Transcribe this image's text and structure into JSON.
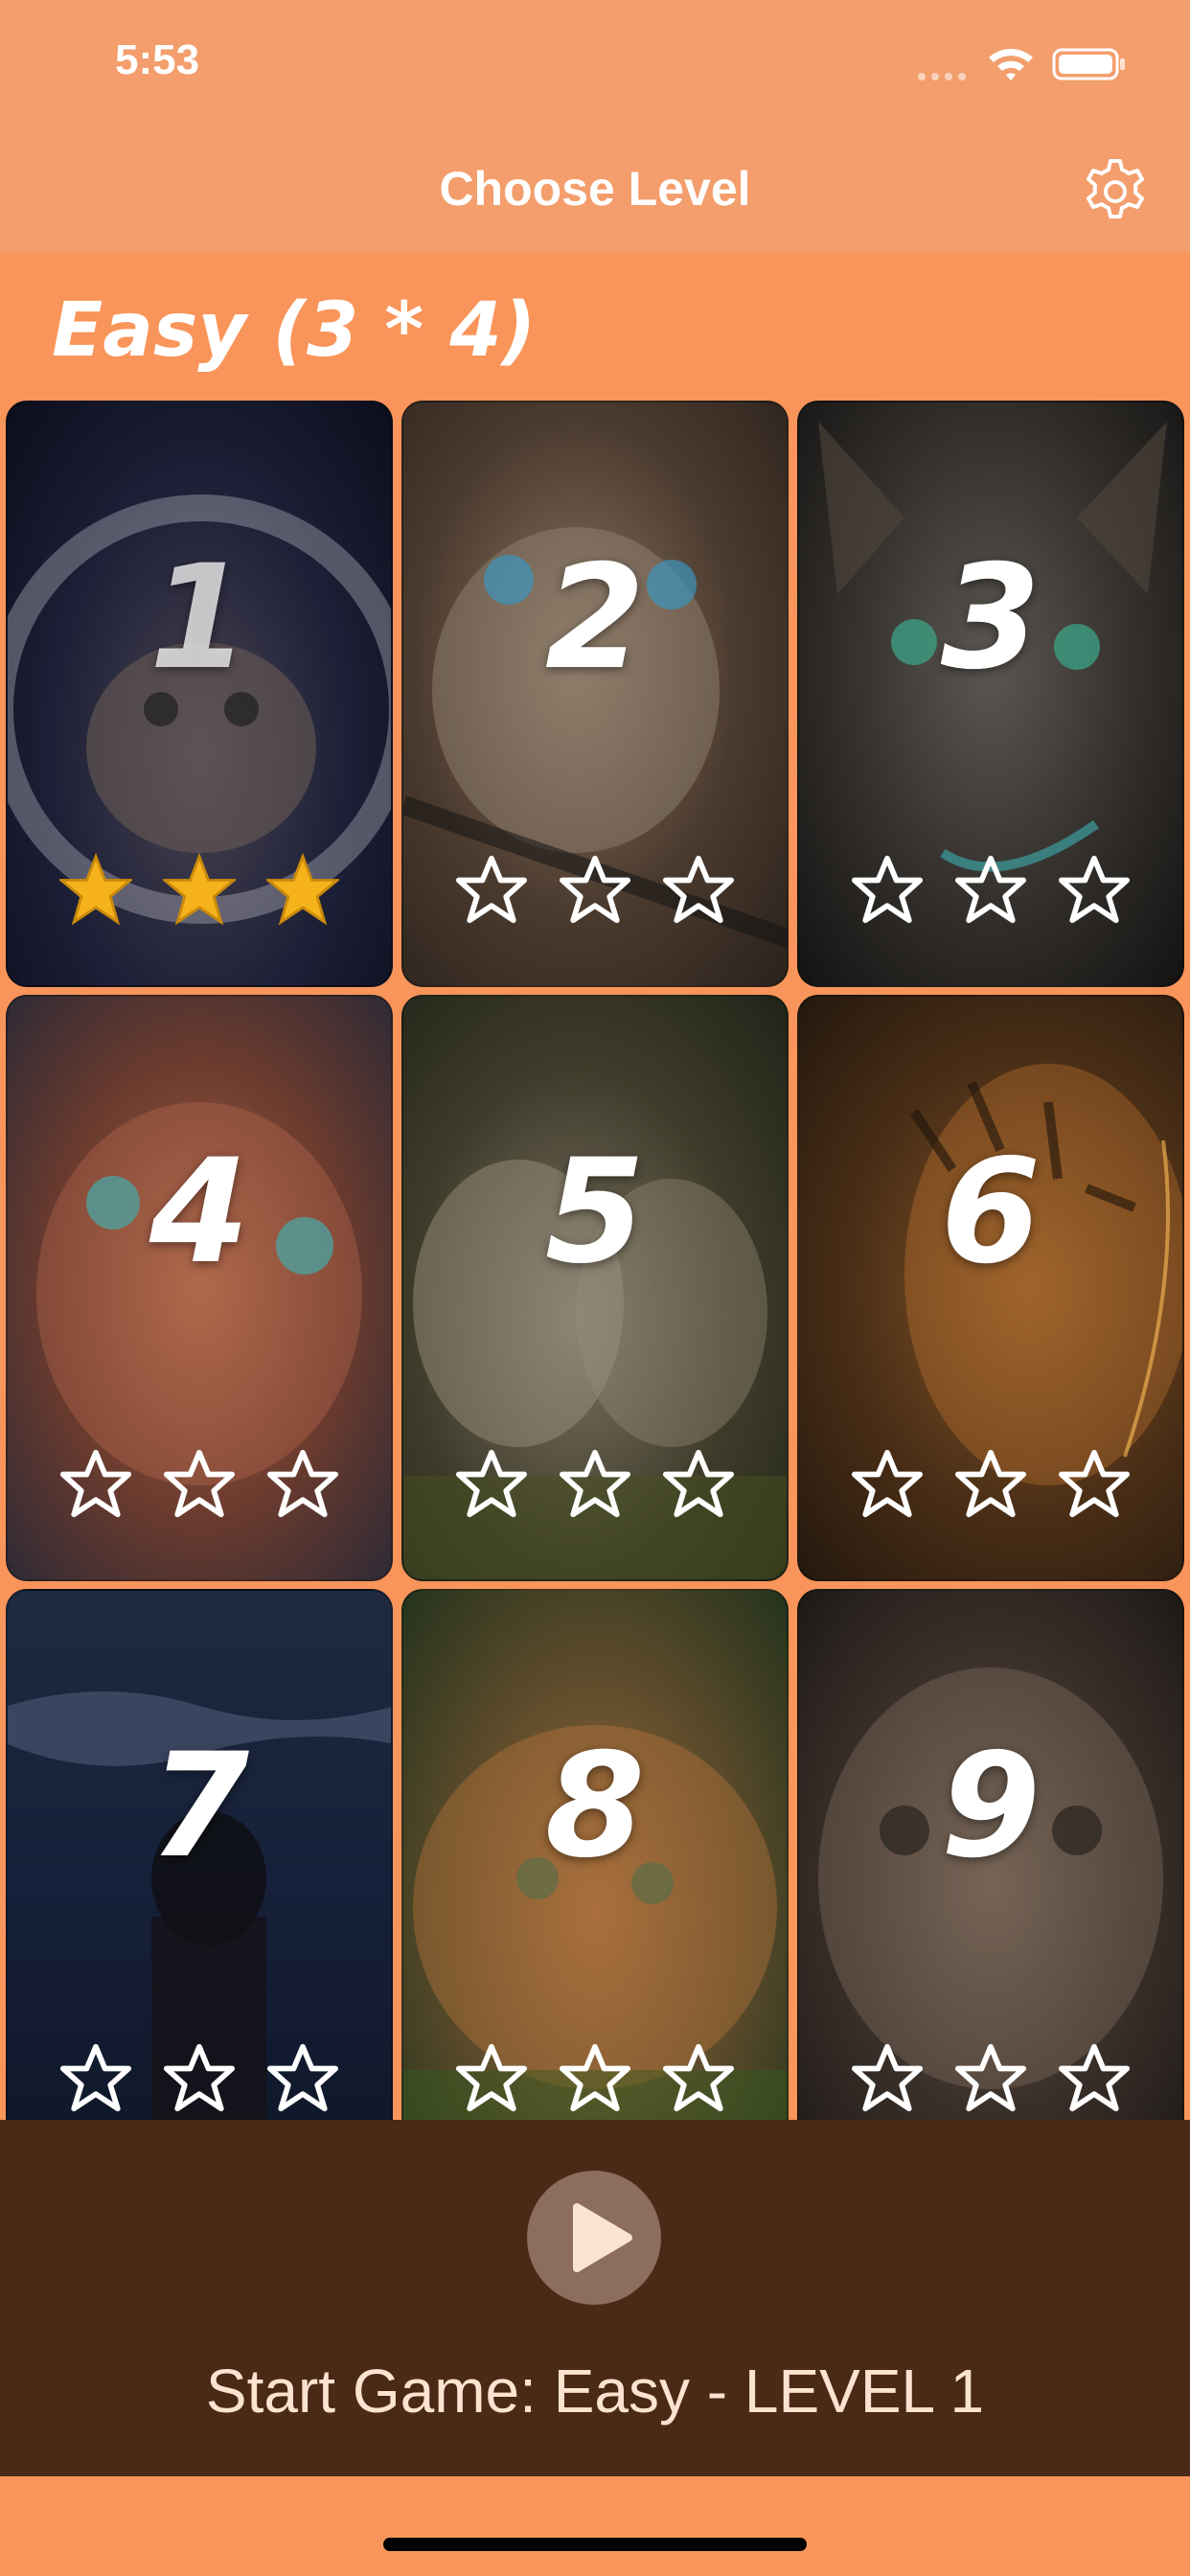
{
  "status_bar": {
    "time": "5:53"
  },
  "nav": {
    "title": "Choose Level",
    "settings_icon": "gear-icon"
  },
  "section": {
    "title": "Easy (3 * 4)"
  },
  "levels": [
    {
      "number": "1",
      "stars_earned": 3,
      "stars_total": 3
    },
    {
      "number": "2",
      "stars_earned": 0,
      "stars_total": 3
    },
    {
      "number": "3",
      "stars_earned": 0,
      "stars_total": 3
    },
    {
      "number": "4",
      "stars_earned": 0,
      "stars_total": 3
    },
    {
      "number": "5",
      "stars_earned": 0,
      "stars_total": 3
    },
    {
      "number": "6",
      "stars_earned": 0,
      "stars_total": 3
    },
    {
      "number": "7",
      "stars_earned": 0,
      "stars_total": 3
    },
    {
      "number": "8",
      "stars_earned": 0,
      "stars_total": 3
    },
    {
      "number": "9",
      "stars_earned": 0,
      "stars_total": 3
    }
  ],
  "bottom": {
    "play_icon": "play-icon",
    "start_label": "Start Game: Easy - LEVEL 1"
  },
  "colors": {
    "header": "#f39e6c",
    "background": "#f9955a",
    "panel": "#4b2917",
    "star_filled": "#f6b21b",
    "star_outline": "#ffffff"
  }
}
